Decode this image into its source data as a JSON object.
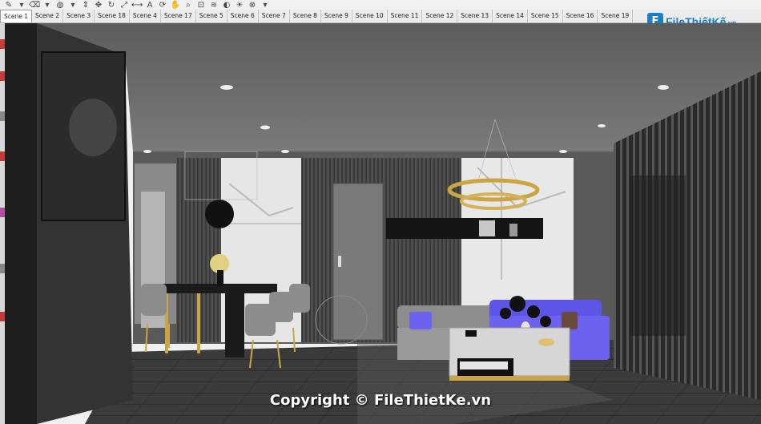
{
  "toolbar": {
    "icons": [
      "pencil-icon",
      "dropdown-arrow-icon",
      "eraser-icon",
      "dropdown-arrow-icon",
      "paint-bucket-icon",
      "dropdown-arrow-icon",
      "push-pull-icon",
      "move-icon",
      "rotate-icon",
      "scale-icon",
      "tape-measure-icon",
      "text-icon",
      "orbit-icon",
      "pan-icon",
      "zoom-icon",
      "zoom-extents-icon",
      "layers-icon",
      "styles-icon",
      "shadows-icon",
      "section-icon",
      "dropdown-arrow-icon"
    ]
  },
  "scenes": {
    "active": "Scene 1",
    "tabs": [
      "Scene 1",
      "Scene 2",
      "Scene 3",
      "Scene 18",
      "Scene 4",
      "Scene 17",
      "Scene 5",
      "Scene 6",
      "Scene 7",
      "Scene 8",
      "Scene 9",
      "Scene 10",
      "Scene 11",
      "Scene 12",
      "Scene 13",
      "Scene 14",
      "Scene 15",
      "Scene 16",
      "Scene 19"
    ]
  },
  "watermark": {
    "logo_mark": "F",
    "logo_name": "FileThiếtKế",
    "logo_suffix": ".vn",
    "copyright": "Copyright © FileThietKe.vn"
  },
  "colors": {
    "ceiling": "#6a6a6a",
    "floor": "#3a3a3a",
    "marble": "#e4e4e4",
    "sofa_gray": "#9a9a9a",
    "sofa_purple": "#6b63f0",
    "gold": "#c9a544",
    "brand_blue": "#1d7fc4"
  }
}
